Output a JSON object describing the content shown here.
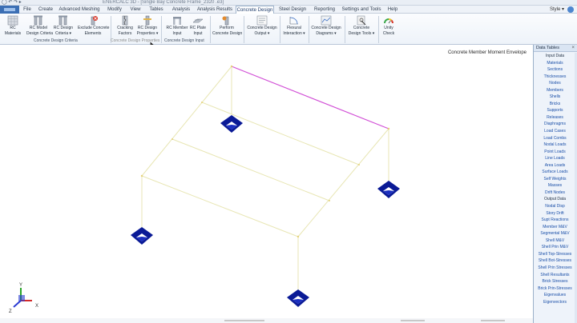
{
  "window": {
    "title": "ENERCALC 3D - [Single Bay Concrete Frame_2320 .e3]"
  },
  "menu": {
    "tabs": [
      "File",
      "Create",
      "Advanced Meshing",
      "Modify",
      "View",
      "Tables",
      "Analysis",
      "Analysis Results",
      "Concrete Design",
      "Steel Design",
      "Reporting",
      "Settings and Tools",
      "Help"
    ],
    "active": "Concrete Design",
    "style_label": "Style"
  },
  "ribbon": {
    "buttons": [
      {
        "name": "rc-materials-button",
        "label1": "RC",
        "label2": "Materials",
        "icon": "grid-icon"
      },
      {
        "name": "rc-model-design-criteria-button",
        "label1": "RC Model",
        "label2": "Design Criteria",
        "icon": "columns-icon"
      },
      {
        "name": "rc-design-criteria-button",
        "label1": "RC Design",
        "label2": "Criteria ▾",
        "icon": "columns-icon"
      },
      {
        "name": "exclude-concrete-elements-button",
        "label1": "Exclude Concrete",
        "label2": "Elements",
        "icon": "exclude-icon"
      },
      {
        "name": "cracking-factors-button",
        "label1": "Cracking",
        "label2": "Factors",
        "icon": "crack-icon"
      },
      {
        "name": "rc-design-properties-button",
        "label1": "RC Design",
        "label2": "Properties ▾",
        "icon": "column-props-icon"
      },
      {
        "name": "rc-member-input-button",
        "label1": "RC Member",
        "label2": "Input",
        "icon": "member-input-icon"
      },
      {
        "name": "rc-plate-input-button",
        "label1": "RC Plate",
        "label2": "Input",
        "icon": "plate-input-icon"
      },
      {
        "name": "perform-concrete-design-button",
        "label1": "Perform",
        "label2": "Concrete Design",
        "icon": "perform-icon"
      },
      {
        "name": "concrete-design-output-button",
        "label1": "Concrete Design",
        "label2": "Output ▾",
        "icon": "output-icon"
      },
      {
        "name": "flexural-interaction-button",
        "label1": "Flexural",
        "label2": "Interaction ▾",
        "icon": "interaction-icon"
      },
      {
        "name": "concrete-design-diagrams-button",
        "label1": "Concrete Design",
        "label2": "Diagrams ▾",
        "icon": "diagram-icon"
      },
      {
        "name": "concrete-design-tools-button",
        "label1": "Concrete",
        "label2": "Design Tools ▾",
        "icon": "tools-icon"
      },
      {
        "name": "unity-check-button",
        "label1": "Unity",
        "label2": "Check",
        "icon": "gauge-icon"
      }
    ],
    "groups": {
      "criteria": "Concrete Design Criteria",
      "properties": "Concrete Design Properties",
      "input": "Concrete Design Input"
    }
  },
  "viewport": {
    "label": "Concrete Member Moment Envelope",
    "axis_labels": {
      "y": "Y",
      "x": "X",
      "z": "Z"
    },
    "colors": {
      "frame": "#e8e6b4",
      "highlight": "#d14fd6",
      "support": "#0a1a96"
    }
  },
  "data_tables": {
    "title": "Data Tables",
    "items": [
      {
        "label": "Input Data",
        "header": true
      },
      {
        "label": "Materials"
      },
      {
        "label": "Sections"
      },
      {
        "label": "Thicknesses"
      },
      {
        "label": "Nodes"
      },
      {
        "label": "Members"
      },
      {
        "label": "Shells"
      },
      {
        "label": "Bricks"
      },
      {
        "label": "Supports"
      },
      {
        "label": "Releases"
      },
      {
        "label": "Diaphragms"
      },
      {
        "label": "Load Cases"
      },
      {
        "label": "Load Combs"
      },
      {
        "label": "Nodal Loads"
      },
      {
        "label": "Point Loads"
      },
      {
        "label": "Line Loads"
      },
      {
        "label": "Area Loads"
      },
      {
        "label": "Surface Loads"
      },
      {
        "label": "Self Weights"
      },
      {
        "label": "Masses"
      },
      {
        "label": "Drift Nodes"
      },
      {
        "label": "Output Data",
        "header": true
      },
      {
        "label": "Nodal Disp"
      },
      {
        "label": "Story Drift"
      },
      {
        "label": "Supt Reactions"
      },
      {
        "label": "Member M&V"
      },
      {
        "label": "Segmental M&V"
      },
      {
        "label": "Shell M&V"
      },
      {
        "label": "Shell Prin M&V"
      },
      {
        "label": "Shell Top-Stresses"
      },
      {
        "label": "Shell Bot-Stresses"
      },
      {
        "label": "Shell Prin Stresses"
      },
      {
        "label": "Shell Resultants"
      },
      {
        "label": "Brick Stresses"
      },
      {
        "label": "Brick Prin-Stresses"
      },
      {
        "label": "Eigenvalues"
      },
      {
        "label": "Eigenvectors"
      }
    ]
  }
}
